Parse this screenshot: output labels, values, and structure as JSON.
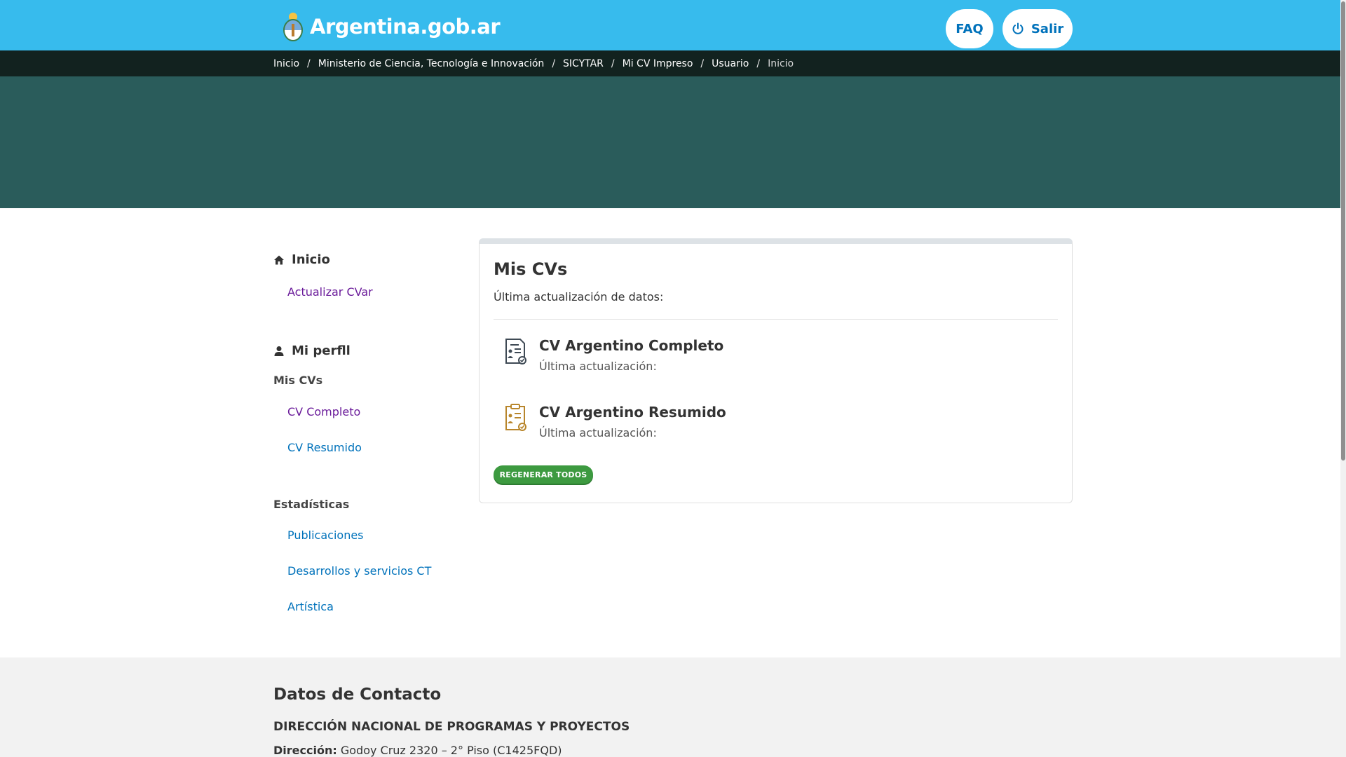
{
  "header": {
    "brand": "Argentina.gob.ar",
    "faq_label": "FAQ",
    "salir_label": "Salir",
    "accent_color": "#37bbed"
  },
  "breadcrumb": [
    "Inicio",
    "Ministerio de Ciencia, Tecnología e Innovación",
    "SICYTAR",
    "Mi CV Impreso",
    "Usuario",
    "Inicio"
  ],
  "sidebar": {
    "home_heading": "Inicio",
    "update_link": "Actualizar CVar",
    "profile_heading": "Mi perfll",
    "mis_cvs_label": "Mis CVs",
    "cv_completo_link": "CV Completo",
    "cv_resumido_link": "CV Resumido",
    "stats_label": "Estadísticas",
    "stats_links": [
      "Publicaciones",
      "Desarrollos y servicios CT",
      "Artística"
    ]
  },
  "main": {
    "title": "Mis CVs",
    "last_update_label": "Última actualización de datos:",
    "cvs": [
      {
        "title": "CV Argentino Completo",
        "date_label": "Última actualización:",
        "icon": "cv-document-icon",
        "color": "#3f4a55"
      },
      {
        "title": "CV Argentino Resumido",
        "date_label": "Última actualización:",
        "icon": "cv-summary-icon",
        "color": "#b8862c"
      }
    ],
    "regen_button": "REGENERAR TODOS"
  },
  "footer": {
    "title": "Datos de Contacto",
    "org": "DIRECCIÓN NACIONAL DE PROGRAMAS Y PROYECTOS",
    "address_label": "Dirección:",
    "address_value": "Godoy Cruz 2320 – 2° Piso (C1425FQD)"
  }
}
